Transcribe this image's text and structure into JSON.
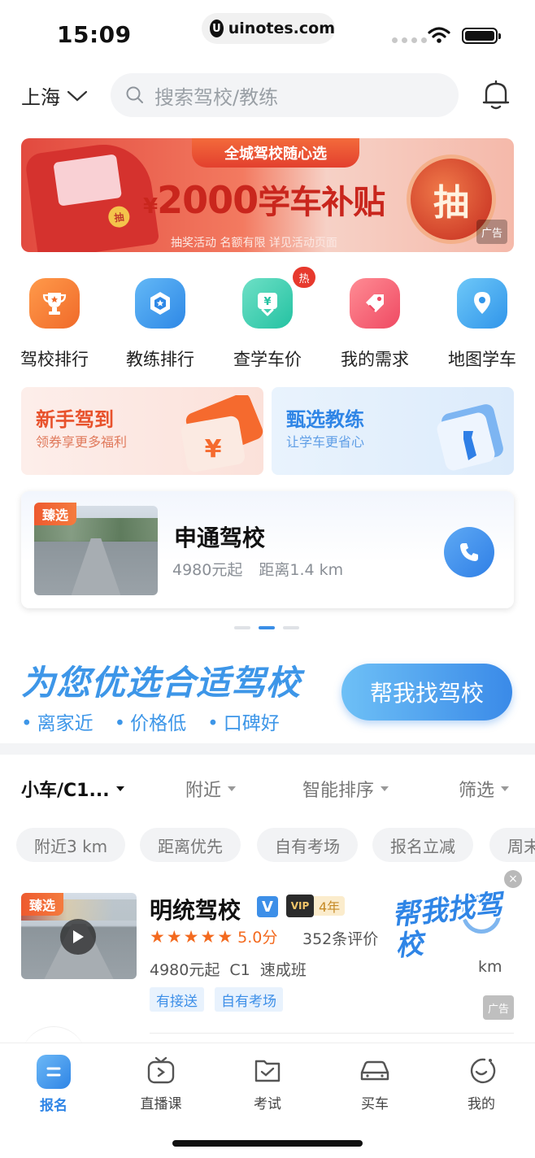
{
  "status_bar": {
    "time": "15:09",
    "url": "uinotes.com",
    "url_logo": "U"
  },
  "header": {
    "city": "上海",
    "search_placeholder": "搜索驾校/教练"
  },
  "banner": {
    "tag": "全城驾校随心选",
    "main_symbol": "¥",
    "main_amount": "2000",
    "main_text": "学车补贴",
    "sub": "抽奖活动 名额有限 详见活动页面",
    "draw_label": "抽",
    "coin_label": "抽",
    "ad_label": "广告"
  },
  "quick_menu": {
    "items": [
      {
        "label": "驾校排行",
        "icon": "trophy-icon"
      },
      {
        "label": "教练排行",
        "icon": "medal-icon"
      },
      {
        "label": "查学车价",
        "icon": "price-download-icon"
      },
      {
        "label": "我的需求",
        "icon": "tag-icon"
      },
      {
        "label": "地图学车",
        "icon": "map-pin-icon"
      }
    ],
    "hot_badge": "热"
  },
  "promos": [
    {
      "title": "新手驾到",
      "subtitle": "领券享更多福利",
      "icon": "coupon-icon",
      "coupon_symbol": "¥"
    },
    {
      "title": "甄选教练",
      "subtitle": "让学车更省心",
      "icon": "gift-tie-icon"
    }
  ],
  "featured": {
    "badge": "臻选",
    "name": "申通驾校",
    "price": "4980元起",
    "distance": "距离1.4 km"
  },
  "recommend": {
    "title": "为您优选合适驾校",
    "points": [
      "离家近",
      "价格低",
      "口碑好"
    ],
    "button": "帮我找驾校"
  },
  "filters": {
    "items": [
      "小车/C1...",
      "附近",
      "智能排序",
      "筛选"
    ],
    "chips": [
      "附近3 km",
      "距离优先",
      "自有考场",
      "报名立减",
      "周末"
    ]
  },
  "school": {
    "badge": "臻选",
    "name": "明统驾校",
    "verified": "V",
    "vip_label": "VIP",
    "vip_years": "4年",
    "rating": 5.0,
    "score": "5.0分",
    "reviews": "352条评价",
    "price": "4980元起",
    "license": "C1",
    "class": "速成班",
    "distance": "km",
    "tags": [
      "有接送",
      "自有考场"
    ],
    "float_ad": "帮我找驾校",
    "close_label": "×",
    "ad_label": "广告"
  },
  "tabbar": {
    "items": [
      {
        "label": "报名",
        "icon": "signup-icon",
        "active": true
      },
      {
        "label": "直播课",
        "icon": "live-class-icon"
      },
      {
        "label": "考试",
        "icon": "exam-icon"
      },
      {
        "label": "买车",
        "icon": "car-icon"
      },
      {
        "label": "我的",
        "icon": "profile-icon"
      }
    ]
  },
  "colors": {
    "brand_blue": "#3d8fe8",
    "accent_orange": "#f36a1f",
    "banner_red": "#e24a3f"
  }
}
